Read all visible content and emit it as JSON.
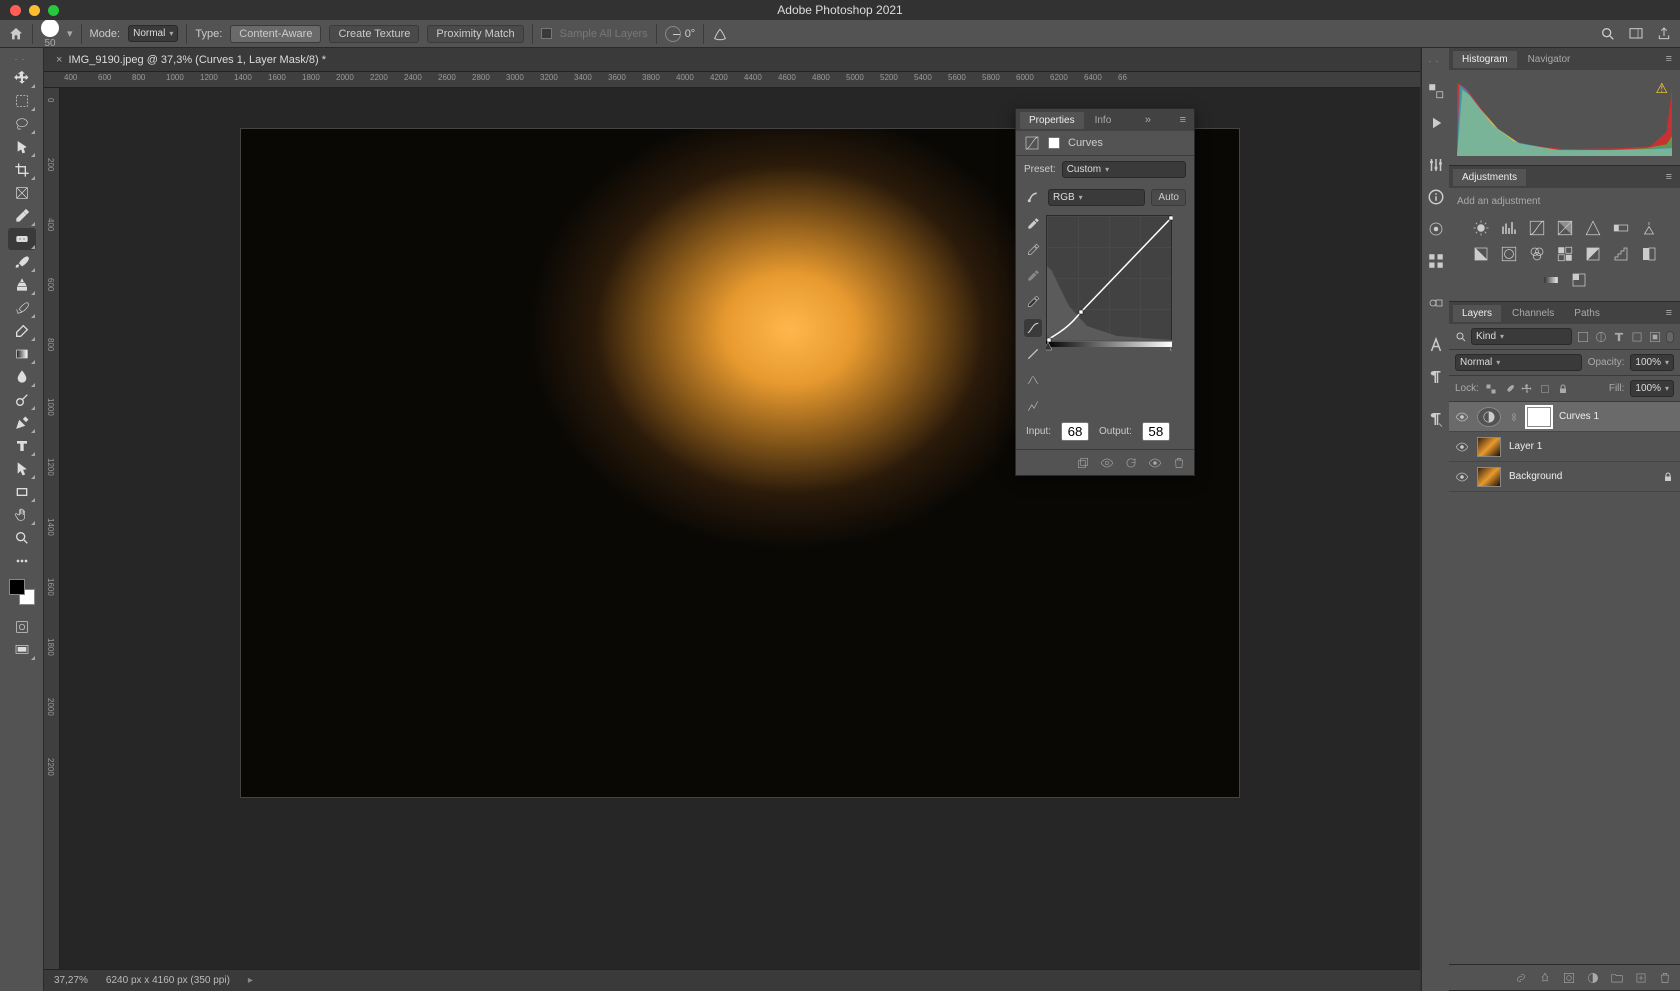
{
  "app": {
    "title": "Adobe Photoshop 2021"
  },
  "document": {
    "tab_title": "IMG_9190.jpeg @ 37,3% (Curves 1, Layer Mask/8) *"
  },
  "options_bar": {
    "brush_size": "50",
    "mode_label": "Mode:",
    "mode_value": "Normal",
    "type_label": "Type:",
    "type_options": {
      "content_aware": "Content-Aware",
      "create_texture": "Create Texture",
      "proximity_match": "Proximity Match"
    },
    "sample_all_label": "Sample All Layers",
    "angle_value": "0°"
  },
  "ruler_marks_h": [
    "400",
    "600",
    "800",
    "1000",
    "1200",
    "1400",
    "1600",
    "1800",
    "2000",
    "2200",
    "2400",
    "2600",
    "2800",
    "3000",
    "3200",
    "3400",
    "3600",
    "3800",
    "4000",
    "4200",
    "4400",
    "4600",
    "4800",
    "5000",
    "5200",
    "5400",
    "5600",
    "5800",
    "6000",
    "6200",
    "6400",
    "66"
  ],
  "ruler_marks_v": [
    "0",
    "200",
    "400",
    "600",
    "800",
    "1000",
    "1200",
    "1400",
    "1600",
    "1800",
    "2000",
    "2200"
  ],
  "properties": {
    "tab_properties": "Properties",
    "tab_info": "Info",
    "type_label": "Curves",
    "preset_label": "Preset:",
    "preset_value": "Custom",
    "channel_value": "RGB",
    "auto_label": "Auto",
    "input_label": "Input:",
    "input_value": "68",
    "output_label": "Output:",
    "output_value": "58"
  },
  "histogram_panel": {
    "tab_histogram": "Histogram",
    "tab_navigator": "Navigator"
  },
  "adjustments_panel": {
    "tab": "Adjustments",
    "hint": "Add an adjustment"
  },
  "layers_panel": {
    "tabs": {
      "layers": "Layers",
      "channels": "Channels",
      "paths": "Paths"
    },
    "kind_label": "Kind",
    "blend_mode": "Normal",
    "opacity_label": "Opacity:",
    "opacity_value": "100%",
    "lock_label": "Lock:",
    "fill_label": "Fill:",
    "fill_value": "100%",
    "layers": [
      {
        "name": "Curves 1",
        "type": "adjustment",
        "selected": true
      },
      {
        "name": "Layer 1",
        "type": "pixel",
        "selected": false
      },
      {
        "name": "Background",
        "type": "pixel",
        "locked": true,
        "selected": false
      }
    ]
  },
  "status_bar": {
    "zoom": "37,27%",
    "doc_info": "6240 px x 4160 px (350 ppi)"
  }
}
